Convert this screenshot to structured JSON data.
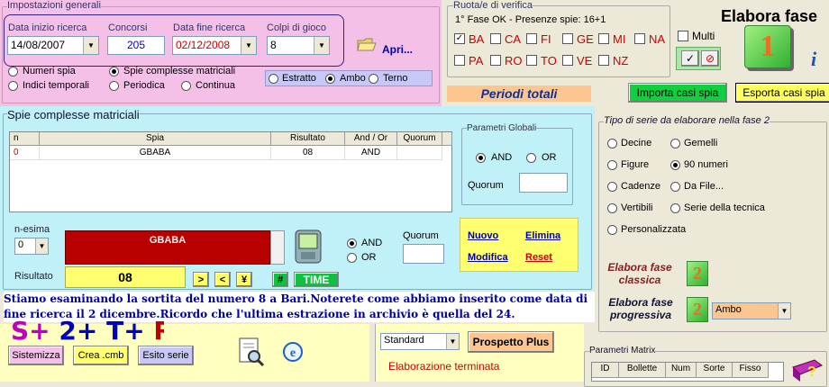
{
  "impostazioni": {
    "title": "Impostazioni generali",
    "data_inizio_label": "Data inizio ricerca",
    "data_inizio": "14/08/2007",
    "concorsi_label": "Concorsi",
    "concorsi": "205",
    "data_fine_label": "Data fine ricerca",
    "data_fine": "02/12/2008",
    "colpi_label": "Colpi di gioco",
    "colpi": "8",
    "apri": "Apri...",
    "opt_numeri_spia": "Numeri spia",
    "opt_spie_complesse": "Spie complesse matriciali",
    "opt_indici": "Indici temporali",
    "opt_periodica": "Periodica",
    "opt_continua": "Continua",
    "opt_estratto": "Estratto",
    "opt_ambo": "Ambo",
    "opt_terno": "Terno"
  },
  "ruote": {
    "title": "Ruota/e di verifica",
    "fase": "1° Fase OK - Presenze spie: 16+1",
    "row1": [
      "BA",
      "CA",
      "FI",
      "GE",
      "MI",
      "NA"
    ],
    "row2": [
      "PA",
      "RO",
      "TO",
      "VE",
      "NZ"
    ],
    "multi": "Multi"
  },
  "elabora": {
    "title": "Elabora fase",
    "badge": "1",
    "periodi": "Periodi totali",
    "importa": "Importa casi spia",
    "esporta": "Esporta casi spia"
  },
  "spie": {
    "title": "Spie complesse matriciali",
    "columns": [
      "n",
      "Spia",
      "Risultato",
      "And / Or",
      "Quorum"
    ],
    "rows": [
      {
        "n": "0",
        "spia": "GBABA",
        "risultato": "08",
        "andor": "AND",
        "quorum": ""
      }
    ],
    "parametri_title": "Parametri Globali",
    "and": "AND",
    "or": "OR",
    "quorum_label": "Quorum",
    "quorum_value": "",
    "nesima_label": "n-esima",
    "nesima": "0",
    "spia_value": "GBABA",
    "risultato_label": "Risultato",
    "risultato": "08",
    "b_gt": ">",
    "b_lt": "<",
    "b_yen": "¥",
    "b_hash": "#",
    "b_time": "TIME",
    "and2": "AND",
    "or2": "OR",
    "quorum2_label": "Quorum",
    "nuovo": "Nuovo",
    "elimina": "Elimina",
    "modifica": "Modifica",
    "reset": "Reset"
  },
  "tipo": {
    "title": "Tipo di serie da elaborare nella fase 2",
    "opts": [
      "Decine",
      "Gemelli",
      "Figure",
      "90 numeri",
      "Cadenze",
      "Da File...",
      "Vertibili",
      "Serie della tecnica",
      "Personalizzata"
    ],
    "classica": "Elabora fase classica",
    "progressiva": "Elabora fase progressiva",
    "badge": "2",
    "ambo": "Ambo"
  },
  "note": "Stiamo esaminando la sortita del numero 8 a Bari.Noterete come abbiamo inserito come data di fine ricerca il 2 dicembre.Ricordo che l'ultima estrazione in archivio è quella del 24.",
  "bottom": {
    "sistemizza": "Sistemizza",
    "crea": "Crea .cmb",
    "esito": "Esito serie",
    "standard": "Standard",
    "prospetto": "Prospetto Plus",
    "terminata": "Elaborazione terminata"
  },
  "matrix": {
    "title": "Parametri Matrix",
    "columns": [
      "ID",
      "Bollette",
      "Num",
      "Sorte",
      "Fisso"
    ]
  },
  "colors": {
    "pink": "#f4c0e8",
    "cyan": "#c0f0f8",
    "accent": "#0000a0"
  }
}
